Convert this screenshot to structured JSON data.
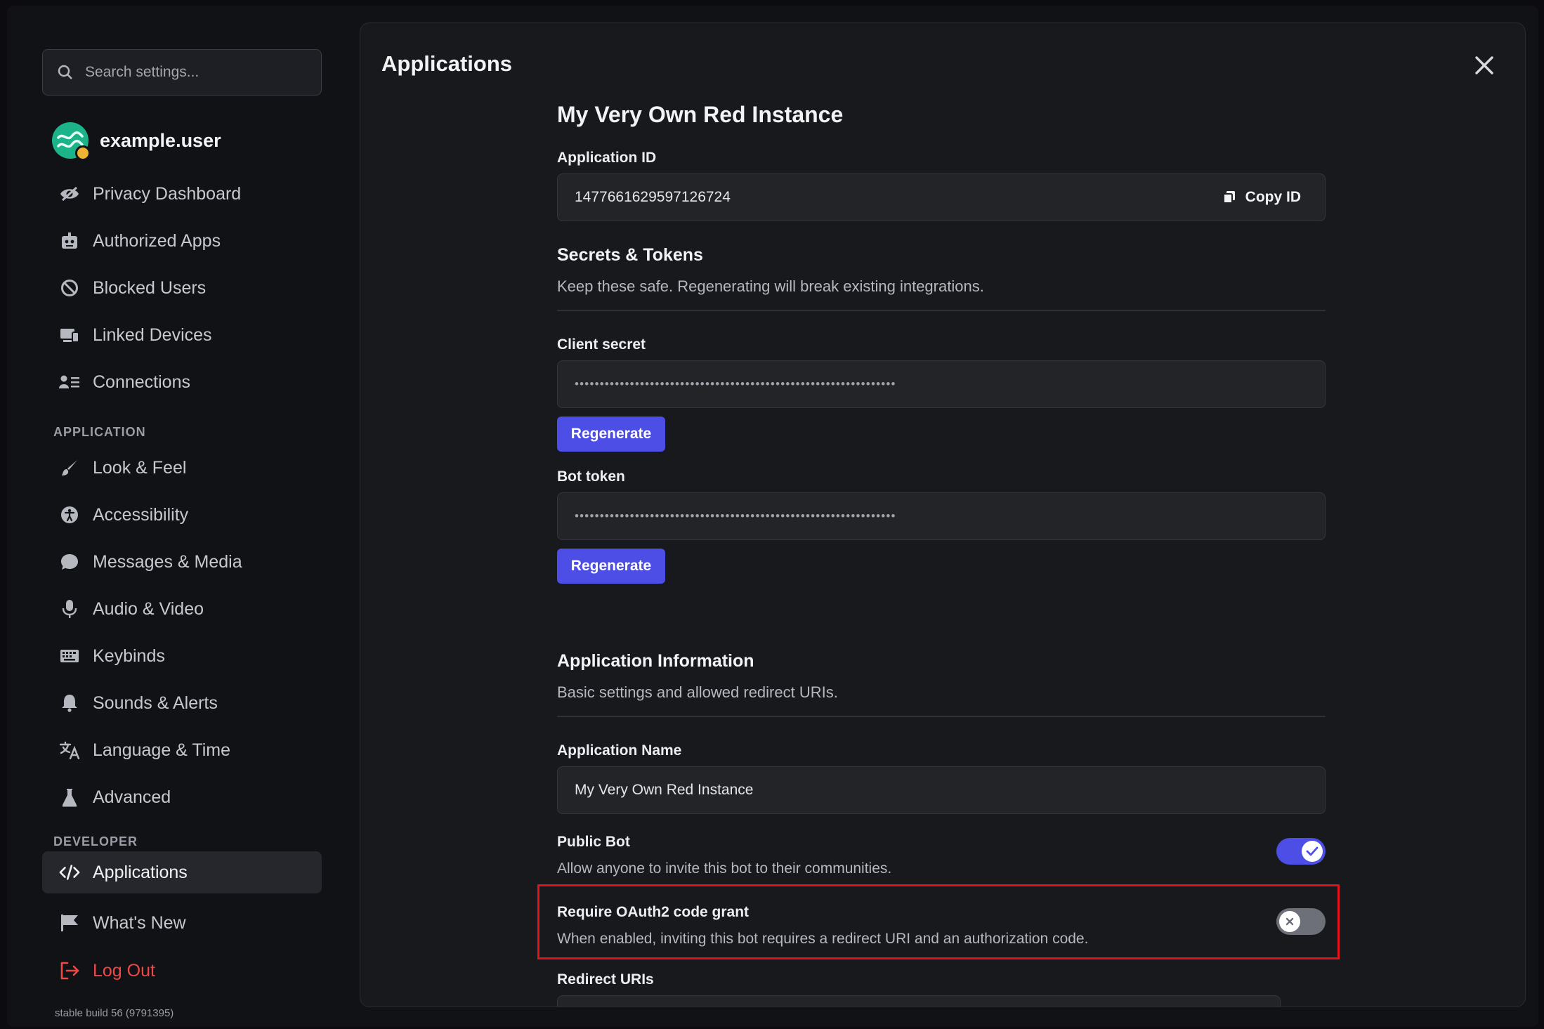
{
  "sidebar": {
    "search_placeholder": "Search settings...",
    "username": "example.user",
    "items_user": [
      {
        "label": "Privacy Dashboard",
        "icon": "eye-slash-icon"
      },
      {
        "label": "Authorized Apps",
        "icon": "robot-icon"
      },
      {
        "label": "Blocked Users",
        "icon": "block-icon"
      },
      {
        "label": "Linked Devices",
        "icon": "devices-icon"
      },
      {
        "label": "Connections",
        "icon": "contact-list-icon"
      }
    ],
    "section_application": "APPLICATION",
    "items_application": [
      {
        "label": "Look & Feel",
        "icon": "brush-icon"
      },
      {
        "label": "Accessibility",
        "icon": "accessibility-icon"
      },
      {
        "label": "Messages & Media",
        "icon": "chat-bubble-icon"
      },
      {
        "label": "Audio & Video",
        "icon": "microphone-icon"
      },
      {
        "label": "Keybinds",
        "icon": "keyboard-icon"
      },
      {
        "label": "Sounds & Alerts",
        "icon": "bell-icon"
      },
      {
        "label": "Language & Time",
        "icon": "translate-icon"
      },
      {
        "label": "Advanced",
        "icon": "flask-icon"
      }
    ],
    "section_developer": "DEVELOPER",
    "applications_label": "Applications",
    "whats_new_label": "What's New",
    "logout_label": "Log Out",
    "build": "stable build 56 (9791395)"
  },
  "panel": {
    "title": "Applications",
    "app_name_heading": "My Very Own Red Instance",
    "application_id_label": "Application ID",
    "application_id": "1477661629597126724",
    "copy_id_label": "Copy ID",
    "secrets": {
      "heading": "Secrets & Tokens",
      "description": "Keep these safe. Regenerating will break existing integrations.",
      "client_secret_label": "Client secret",
      "client_secret_mask": "••••••••••••••••••••••••••••••••••••••••••••••••••••••••••••••••",
      "bot_token_label": "Bot token",
      "bot_token_mask": "••••••••••••••••••••••••••••••••••••••••••••••••••••••••••••••••",
      "regenerate_label": "Regenerate"
    },
    "info": {
      "heading": "Application Information",
      "description": "Basic settings and allowed redirect URIs.",
      "name_label": "Application Name",
      "name_value": "My Very Own Red Instance",
      "public_bot_label": "Public Bot",
      "public_bot_desc": "Allow anyone to invite this bot to their communities.",
      "public_bot_enabled": true,
      "oauth_label": "Require OAuth2 code grant",
      "oauth_desc": "When enabled, inviting this bot requires a redirect URI and an authorization code.",
      "oauth_enabled": false,
      "redirect_label": "Redirect URIs"
    }
  },
  "colors": {
    "accent": "#4d4ee6",
    "danger": "#f04747",
    "highlight_box": "#e0151b"
  }
}
